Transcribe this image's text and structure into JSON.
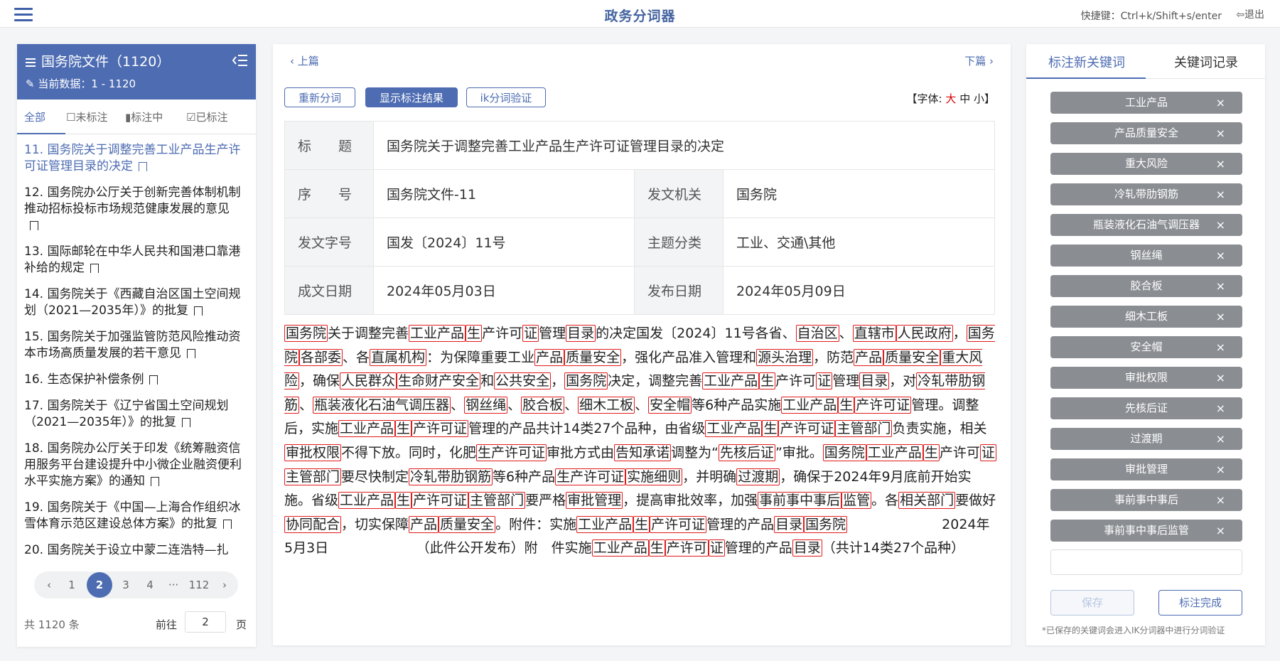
{
  "header": {
    "title": "政务分词器",
    "hotkeys": "快捷键：Ctrl+k/Shift+s/enter",
    "logout": "退出"
  },
  "left": {
    "title": "国务院文件（1120）",
    "current": "当前数据：1 - 1120",
    "tabs": [
      "全部",
      "未标注",
      "标注中",
      "已标注"
    ],
    "docs": [
      "11. 国务院关于调整完善工业产品生产许可证管理目录的决定",
      "12. 国务院办公厅关于创新完善体制机制推动招标投标市场规范健康发展的意见",
      "13. 国际邮轮在中华人民共和国港口靠港补给的规定",
      "14. 国务院关于《西藏自治区国土空间规划（2021—2035年）》的批复",
      "15. 国务院关于加强监管防范风险推动资本市场高质量发展的若干意见",
      "16. 生态保护补偿条例",
      "17. 国务院关于《辽宁省国土空间规划（2021—2035年）》的批复",
      "18. 国务院办公厅关于印发《统筹融资信用服务平台建设提升中小微企业融资便利水平实施方案》的通知",
      "19. 国务院关于《中国—上海合作组织冰雪体育示范区建设总体方案》的批复",
      "20. 国务院关于设立中蒙二连浩特—扎"
    ],
    "pager": {
      "prev": "‹",
      "p1": "1",
      "p2": "2",
      "p3": "3",
      "p4": "4",
      "ellipsis": "···",
      "last": "112",
      "next": "›"
    },
    "total": "共 1120 条",
    "goto_label": "前往",
    "goto_value": "2",
    "page_word": "页"
  },
  "center": {
    "prev": "上篇",
    "next": "下篇",
    "btn_resegment": "重新分词",
    "btn_show": "显示标注结果",
    "btn_ik": "ik分词验证",
    "font_label": "【字体:",
    "font_large": "大",
    "font_medium": "中",
    "font_small": "小】",
    "meta": {
      "title_label": "标　　题",
      "title": "国务院关于调整完善工业产品生产许可证管理目录的决定",
      "seq_label": "序　　号",
      "seq": "国务院文件-11",
      "issuer_label": "发文机关",
      "issuer": "国务院",
      "docno_label": "发文字号",
      "docno": "国发〔2024〕11号",
      "topic_label": "主题分类",
      "topic": "工业、交通\\其他",
      "date_label": "成文日期",
      "date": "2024年05月03日",
      "pub_label": "发布日期",
      "pub": "2024年05月09日"
    },
    "body": [
      [
        "国务院",
        true
      ],
      [
        "关于调整完善",
        false
      ],
      [
        "工业产品",
        true
      ],
      [
        "生",
        true
      ],
      [
        "产许可",
        false
      ],
      [
        "证",
        true
      ],
      [
        "管理",
        false
      ],
      [
        "目录",
        true
      ],
      [
        "的决定国发〔2024〕11号各省、",
        false
      ],
      [
        "自治区",
        true
      ],
      [
        "、",
        false
      ],
      [
        "直辖市",
        true
      ],
      [
        "人民政府",
        true
      ],
      [
        "，",
        false
      ],
      [
        "国务院",
        true
      ],
      [
        "各部委",
        true
      ],
      [
        "、各",
        false
      ],
      [
        "直属机构",
        true
      ],
      [
        "：为保障重要工业",
        false
      ],
      [
        "产品",
        true
      ],
      [
        "质量安全",
        true
      ],
      [
        "，强化产品准入管理和",
        false
      ],
      [
        "源头治理",
        true
      ],
      [
        "，防范",
        false
      ],
      [
        "产品",
        true
      ],
      [
        "质量安全",
        true
      ],
      [
        "重大风险",
        true
      ],
      [
        "，确保",
        false
      ],
      [
        "人民群众",
        true
      ],
      [
        "生命财产安全",
        true
      ],
      [
        "和",
        false
      ],
      [
        "公共安全",
        true
      ],
      [
        "，",
        false
      ],
      [
        "国务院",
        true
      ],
      [
        "决定，调整完善",
        false
      ],
      [
        "工业产品",
        true
      ],
      [
        "生",
        true
      ],
      [
        "产许可",
        false
      ],
      [
        "证",
        true
      ],
      [
        "管理",
        false
      ],
      [
        "目录",
        true
      ],
      [
        "，对",
        false
      ],
      [
        "冷轧带肋钢筋",
        true
      ],
      [
        "、",
        false
      ],
      [
        "瓶装液化石油气调压器",
        true
      ],
      [
        "、",
        false
      ],
      [
        "钢丝绳",
        true
      ],
      [
        "、",
        false
      ],
      [
        "胶合板",
        true
      ],
      [
        "、",
        false
      ],
      [
        "细木工板",
        true
      ],
      [
        "、",
        false
      ],
      [
        "安全帽",
        true
      ],
      [
        "等6种产品实施",
        false
      ],
      [
        "工业产品",
        true
      ],
      [
        "生",
        true
      ],
      [
        "产许可证",
        true
      ],
      [
        "管理。调整后，实施",
        false
      ],
      [
        "工业产品",
        true
      ],
      [
        "生",
        true
      ],
      [
        "产许可证",
        true
      ],
      [
        "管理的产品共计14类27个品种，由省级",
        false
      ],
      [
        "工业产品",
        true
      ],
      [
        "生",
        true
      ],
      [
        "产许可证",
        true
      ],
      [
        "主管部门",
        true
      ],
      [
        "负责实施，相关",
        false
      ],
      [
        "审批权限",
        true
      ],
      [
        "不得下放。同时，化肥",
        false
      ],
      [
        "生产许可证",
        true
      ],
      [
        "审批方式由",
        false
      ],
      [
        "告知承诺",
        true
      ],
      [
        "调整为“",
        false
      ],
      [
        "先核后证",
        true
      ],
      [
        "”审批。",
        false
      ],
      [
        "国务院",
        true
      ],
      [
        "工业产品",
        true
      ],
      [
        "生",
        true
      ],
      [
        "产许可",
        false
      ],
      [
        "证",
        true
      ],
      [
        "主管部门",
        true
      ],
      [
        "要尽快制定",
        false
      ],
      [
        "冷轧带肋钢筋",
        true
      ],
      [
        "等6种产品",
        false
      ],
      [
        "生产许可证",
        true
      ],
      [
        "实施细则",
        true
      ],
      [
        "，并明确",
        false
      ],
      [
        "过渡期",
        true
      ],
      [
        "，确保于2024年9月底前开始实施。省级",
        false
      ],
      [
        "工业产品",
        true
      ],
      [
        "生",
        true
      ],
      [
        "产许可证",
        true
      ],
      [
        "主管部门",
        true
      ],
      [
        "要严格",
        false
      ],
      [
        "审批管理",
        true
      ],
      [
        "，提高审批效率，加强",
        false
      ],
      [
        "事前事中事后",
        true
      ],
      [
        "监管",
        true
      ],
      [
        "。各",
        false
      ],
      [
        "相关部门",
        true
      ],
      [
        "要做好",
        false
      ],
      [
        "协同配合",
        true
      ],
      [
        "，切实保障",
        false
      ],
      [
        "产品",
        true
      ],
      [
        "质量安全",
        true
      ],
      [
        "。附件：实施",
        false
      ],
      [
        "工业产品",
        true
      ],
      [
        "生",
        true
      ],
      [
        "产许可证",
        true
      ],
      [
        "管理的产品",
        false
      ],
      [
        "目录",
        true
      ],
      [
        "国务院",
        true
      ],
      [
        "　　　　　　　2024年5月3日　　　　　　　（此件公开发布）附　件实施",
        false
      ],
      [
        "工业产品",
        true
      ],
      [
        "生",
        true
      ],
      [
        "产许可",
        true
      ],
      [
        "证",
        true
      ],
      [
        "管理的产品",
        false
      ],
      [
        "目录",
        true
      ],
      [
        "（共计14类27个品种）",
        false
      ]
    ]
  },
  "right": {
    "tab_new": "标注新关键词",
    "tab_record": "关键词记录",
    "keywords": [
      "工业产品",
      "产品质量安全",
      "重大风险",
      "冷轧带肋钢筋",
      "瓶装液化石油气调压器",
      "钢丝绳",
      "胶合板",
      "细木工板",
      "安全帽",
      "审批权限",
      "先核后证",
      "过渡期",
      "审批管理",
      "事前事中事后",
      "事前事中事后监管"
    ],
    "remove": "×",
    "save": "保存",
    "done": "标注完成",
    "note": "*已保存的关键词会进入IK分词器中进行分词验证"
  }
}
